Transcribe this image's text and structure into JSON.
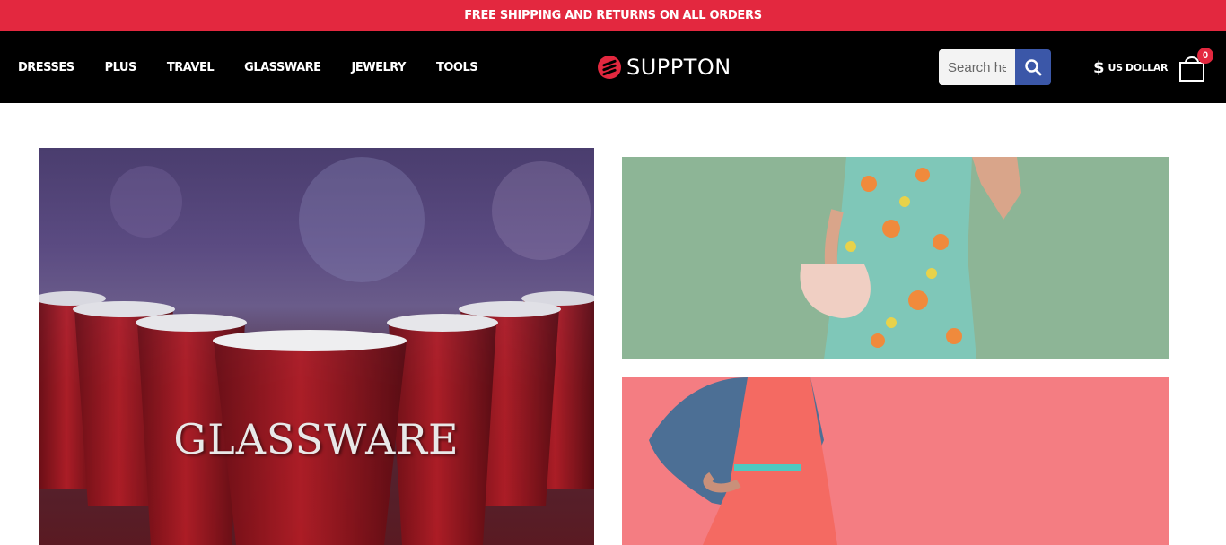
{
  "promo": {
    "text": "FREE SHIPPING AND RETURNS ON ALL ORDERS"
  },
  "nav": {
    "items": [
      {
        "label": "DRESSES"
      },
      {
        "label": "PLUS"
      },
      {
        "label": "TRAVEL"
      },
      {
        "label": "GLASSWARE"
      },
      {
        "label": "JEWELRY"
      },
      {
        "label": "TOOLS"
      }
    ]
  },
  "logo": {
    "text": "SUPPTON",
    "icon": "suppton-logo-mark"
  },
  "search": {
    "placeholder": "Search here...",
    "icon": "search-icon"
  },
  "currency": {
    "symbol": "$",
    "label": "US DOLLAR"
  },
  "cart": {
    "count": "0",
    "icon": "shopping-bag-icon"
  },
  "banners": {
    "glassware": {
      "title": "GLASSWARE"
    },
    "dress": {},
    "pink": {}
  },
  "colors": {
    "accent": "#e3283f",
    "header_bg": "#000000",
    "search_button": "#3b57a8"
  }
}
